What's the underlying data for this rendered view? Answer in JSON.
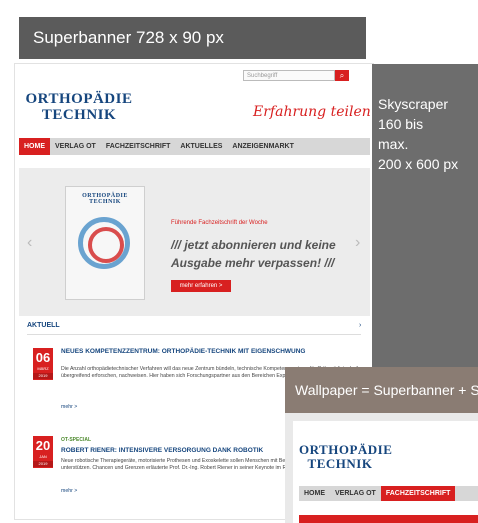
{
  "superbanner": {
    "label": "Superbanner 728 x 90 px"
  },
  "skyscraper": {
    "lines": [
      "Skyscraper",
      "160 bis",
      "max.",
      "200 x 600 px"
    ]
  },
  "wallpaper": {
    "label": "Wallpaper = Superbanner + Skyscraper"
  },
  "site": {
    "search_placeholder": "Suchbegriff",
    "logo_line1": "ORTHOPÄDIE",
    "logo_line2": "TECHNIK",
    "tagline": "Erfahrung teilen",
    "nav": [
      "HOME",
      "VERLAG OT",
      "FACHZEITSCHRIFT",
      "AKTUELLES",
      "ANZEIGENMARKT"
    ],
    "slider": {
      "cover_title": "ORTHOPÄDIE TECHNIK",
      "promo_small": "Führende Fachzeitschrift der Woche",
      "promo_line1": "/// jetzt abonnieren und keine",
      "promo_line2": "Ausgabe mehr verpassen! ///",
      "button": "mehr erfahren >"
    },
    "news": {
      "label": "AKTUELL",
      "items": [
        {
          "day": "06",
          "month": "MÄRZ",
          "year": "2019",
          "headline": "NEUES KOMPETENZZENTRUM: ORTHOPÄDIE-TECHNIK MIT EIGENSCHWUNG",
          "body": "Die Anzahl orthopädietechnischer Verfahren will das neue Zentrum bündeln, technische Kompetenzzentrum für Orthopädietechnik übergreifend erforschen, nachweisen. Hier haben sich Forschungspartner aus den Bereichen Expertengruppen – Wolkin Lab ...",
          "more": "mehr >"
        },
        {
          "day": "20",
          "month": "JAN",
          "year": "2019",
          "badge": "OT-SPECIAL",
          "headline": "ROBERT RIENER: INTENSIVERE VERSORGUNG DANK ROBOTIK",
          "body": "Neue robotische Therapiegeräte, motorisierte Prothesen und Exoskelette sollen Menschen mit Bewegungseinschränkungen unterstützen. Chancen und Grenzen erläuterte Prof. Dr.-Ing. Robert Riener in seiner Keynote im Rahmen der OT...",
          "more": "mehr >"
        }
      ]
    }
  },
  "wallpaper_site": {
    "logo_line1": "ORTHOPÄDIE",
    "logo_line2": "TECHNIK",
    "nav": [
      "HOME",
      "VERLAG OT",
      "FACHZEITSCHRIFT"
    ]
  }
}
